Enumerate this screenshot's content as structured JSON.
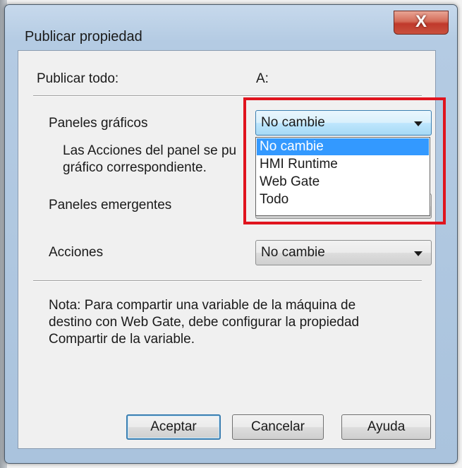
{
  "window": {
    "title": "Publicar propiedad",
    "close_icon": "close-icon",
    "close_glyph": "X"
  },
  "header": {
    "left_label": "Publicar todo:",
    "right_label": "A:"
  },
  "rows": {
    "paneles_graficos": {
      "label": "Paneles gráficos",
      "value": "No cambie"
    },
    "description": "Las Acciones del panel se pu\ngráfico correspondiente.",
    "paneles_emergentes": {
      "label": "Paneles emergentes"
    },
    "acciones": {
      "label": "Acciones",
      "value": "No cambie"
    }
  },
  "dropdown": {
    "options": [
      "No cambie",
      "HMI Runtime",
      "Web Gate",
      "Todo"
    ],
    "selected": "No cambie"
  },
  "note": "Nota: Para compartir una variable de la máquina de\ndestino con Web Gate, debe configurar la propiedad\nCompartir de la variable.",
  "buttons": {
    "ok": "Aceptar",
    "cancel": "Cancelar",
    "help": "Ayuda"
  },
  "colors": {
    "highlight": "#e0141e",
    "selection": "#3399ff",
    "focus_border": "#3c7fb1"
  }
}
